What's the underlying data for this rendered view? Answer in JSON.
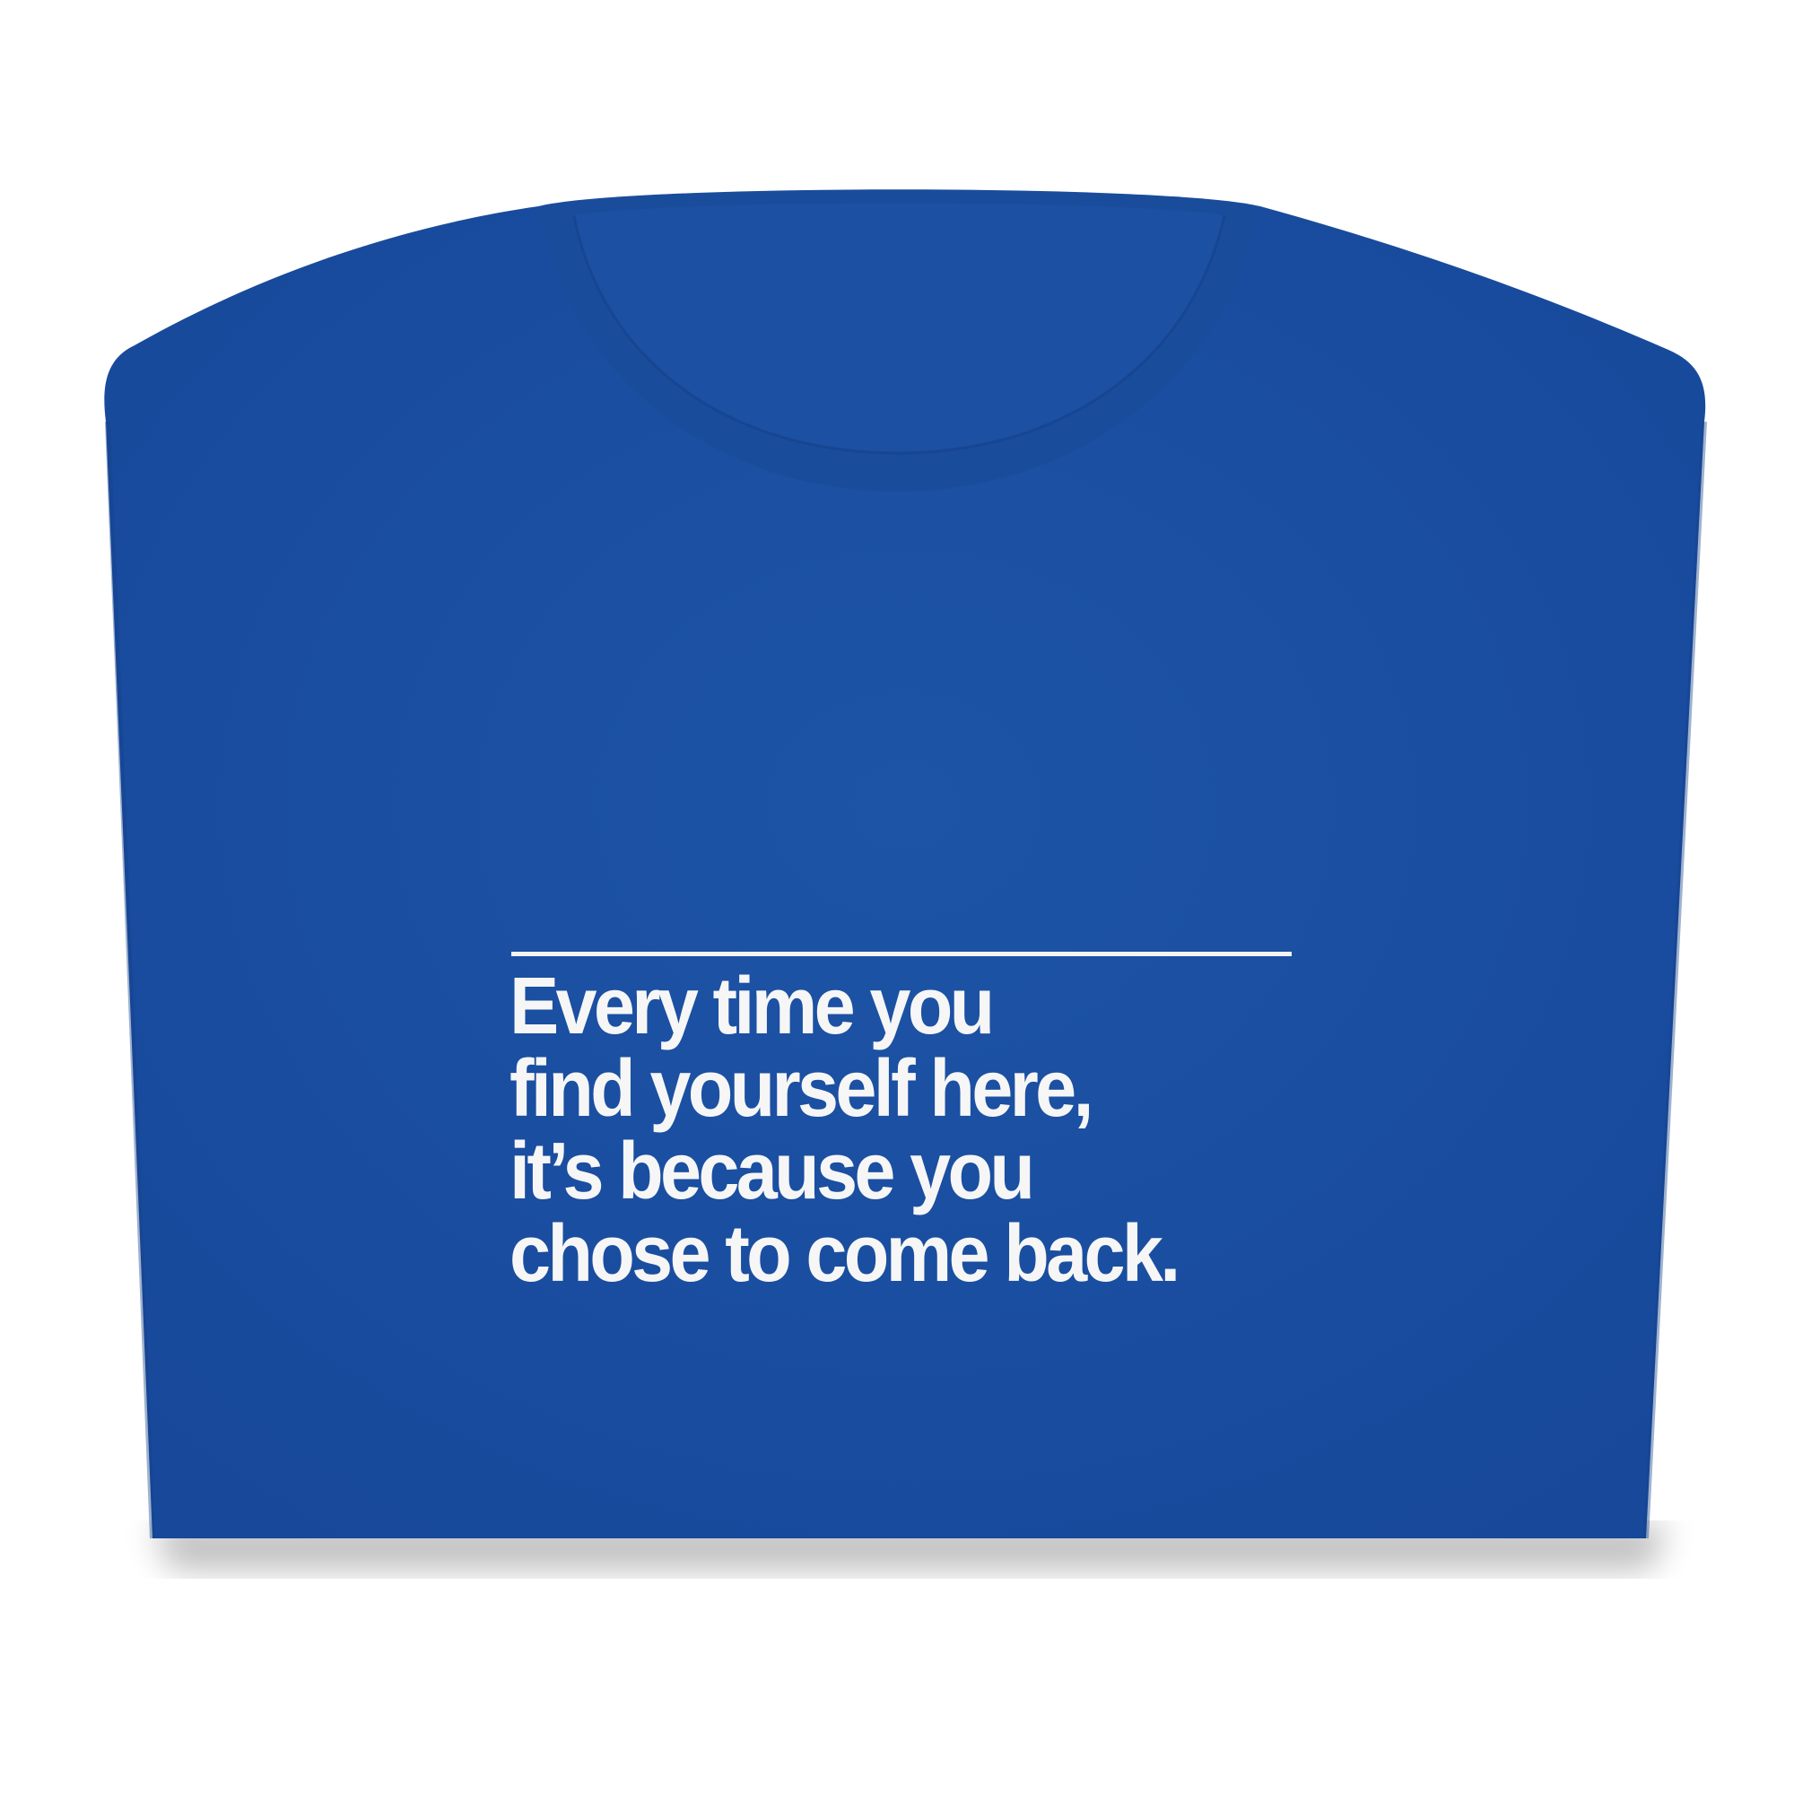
{
  "product": {
    "shirt_color": "#1b4f9f",
    "print_color": "#f6f6f6",
    "quote_lines": [
      "Every time you",
      "find yourself here,",
      "it’s because you",
      "chose to come back."
    ]
  }
}
